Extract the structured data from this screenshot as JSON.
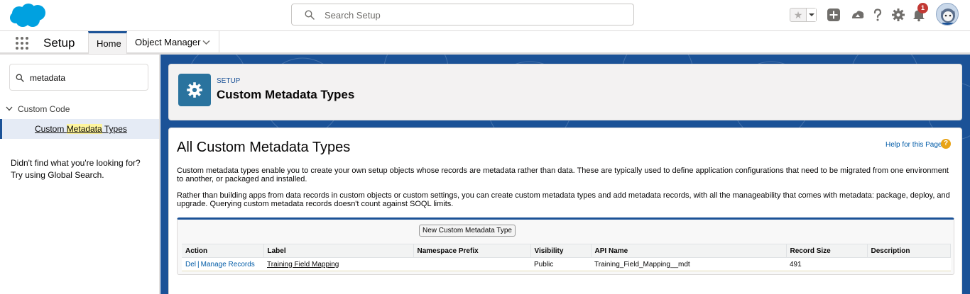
{
  "header": {
    "logo": "salesforce-cloud-logo",
    "search_placeholder": "Search Setup",
    "notification_count": "1",
    "icons": [
      "star-icon",
      "chevron-down-icon",
      "plus-icon",
      "trailhead-icon",
      "help-icon",
      "gear-icon",
      "bell-icon",
      "avatar"
    ]
  },
  "nav": {
    "app_name": "Setup",
    "tabs": [
      {
        "label": "Home"
      },
      {
        "label": "Object Manager"
      }
    ]
  },
  "sidebar": {
    "quick_find_value": "metadata",
    "parent_label": "Custom Code",
    "child_label_before": "Custom ",
    "child_label_match": "Metadata",
    "child_label_after": " Types",
    "help_line1": "Didn't find what you're looking for?",
    "help_line2": "Try using Global Search."
  },
  "page_header": {
    "eyebrow": "SETUP",
    "title": "Custom Metadata Types"
  },
  "content": {
    "title": "All Custom Metadata Types",
    "help_link": "Help for this Page",
    "help_icon": "?",
    "desc1": "Custom metadata types enable you to create your own setup objects whose records are metadata rather than data. These are typically used to define application configurations that need to be migrated from one environment to another, or packaged and installed.",
    "desc2": "Rather than building apps from data records in custom objects or custom settings, you can create custom metadata types and add metadata records, with all the manageability that comes with metadata: package, deploy, and upgrade. Querying custom metadata records doesn't count against SOQL limits.",
    "new_button": "New Custom Metadata Type",
    "columns": [
      "Action",
      "Label",
      "Namespace Prefix",
      "Visibility",
      "API Name",
      "Record Size",
      "Description"
    ],
    "rows": [
      {
        "action_del": "Del",
        "action_sep": "|",
        "action_manage": "Manage Records",
        "label": "Training Field Mapping",
        "namespace": "",
        "visibility": "Public",
        "api_name": "Training_Field_Mapping__mdt",
        "record_size": "491",
        "description": ""
      }
    ]
  },
  "colors": {
    "brand_blue": "#1b5297",
    "link_blue": "#015ba7",
    "setup_icon_bg": "#2a739e",
    "badge_red": "#c23934",
    "help_orange": "#e8a317"
  }
}
